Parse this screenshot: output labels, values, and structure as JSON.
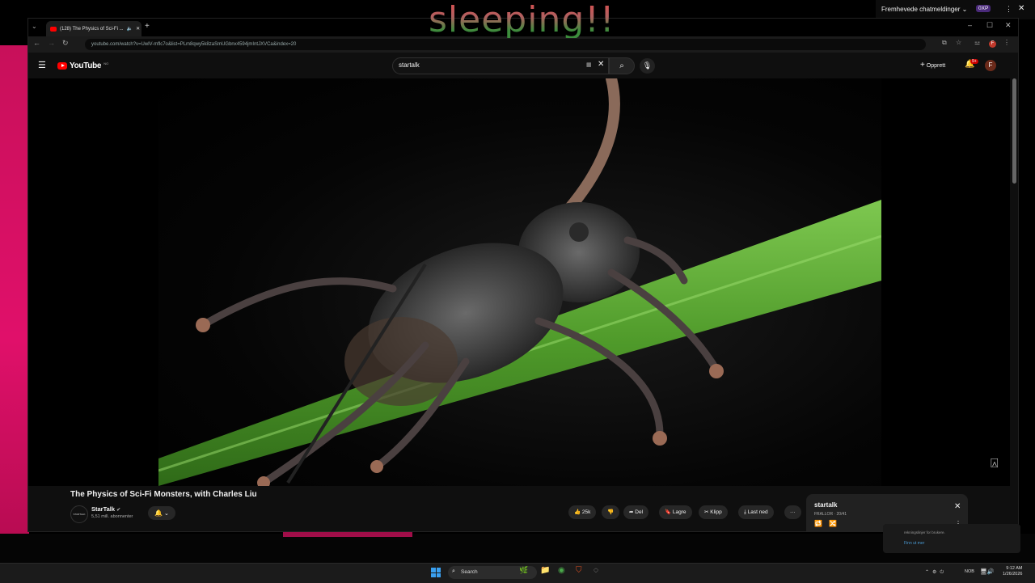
{
  "overlay_text": "sleeping!!",
  "chat_widget": {
    "label": "Fremhevede chatmeldinger",
    "xp_badge": "0XP",
    "more": "⋮",
    "close": "✕"
  },
  "browser": {
    "tab_title": "(128) The Physics of Sci-Fi ...",
    "tab_close": "✕",
    "new_tab": "+",
    "url": "youtube.com/watch?v=UwlV-mflc7o&list=PLm8qwy5k8zaSmUGbnx4594jmIntJXVCa&index=20",
    "profile_initial": "F",
    "window_controls": [
      "–",
      "☐",
      "✕"
    ]
  },
  "youtube": {
    "logo": "YouTube",
    "logo_region": "NO",
    "search_value": "startalk",
    "create_label": "Opprett",
    "notification_count": "9+",
    "avatar_initial": "F"
  },
  "video": {
    "title": "The Physics of Sci-Fi Monsters, with Charles Liu",
    "channel": "StarTalk",
    "channel_avatar_text": "STARTALK",
    "subscribers": "5,51 mill. abonnenter",
    "likes": "25k",
    "share_label": "Del",
    "save_label": "Lagre",
    "clip_label": "Klipp",
    "download_label": "Last ned"
  },
  "playlist": {
    "title": "startalk",
    "subtitle": "FRALLOR · 20/41"
  },
  "notification": {
    "text": "rekningslinjer for brukere.",
    "link": "Finn ut mer"
  },
  "taskbar": {
    "search_label": "Search",
    "language": "NOB",
    "time": "9:12 AM",
    "date": "1/26/2026"
  },
  "colors": {
    "accent_red": "#ff0000",
    "desktop_pink": "#e0106a",
    "stem_green": "#5aa02c"
  }
}
